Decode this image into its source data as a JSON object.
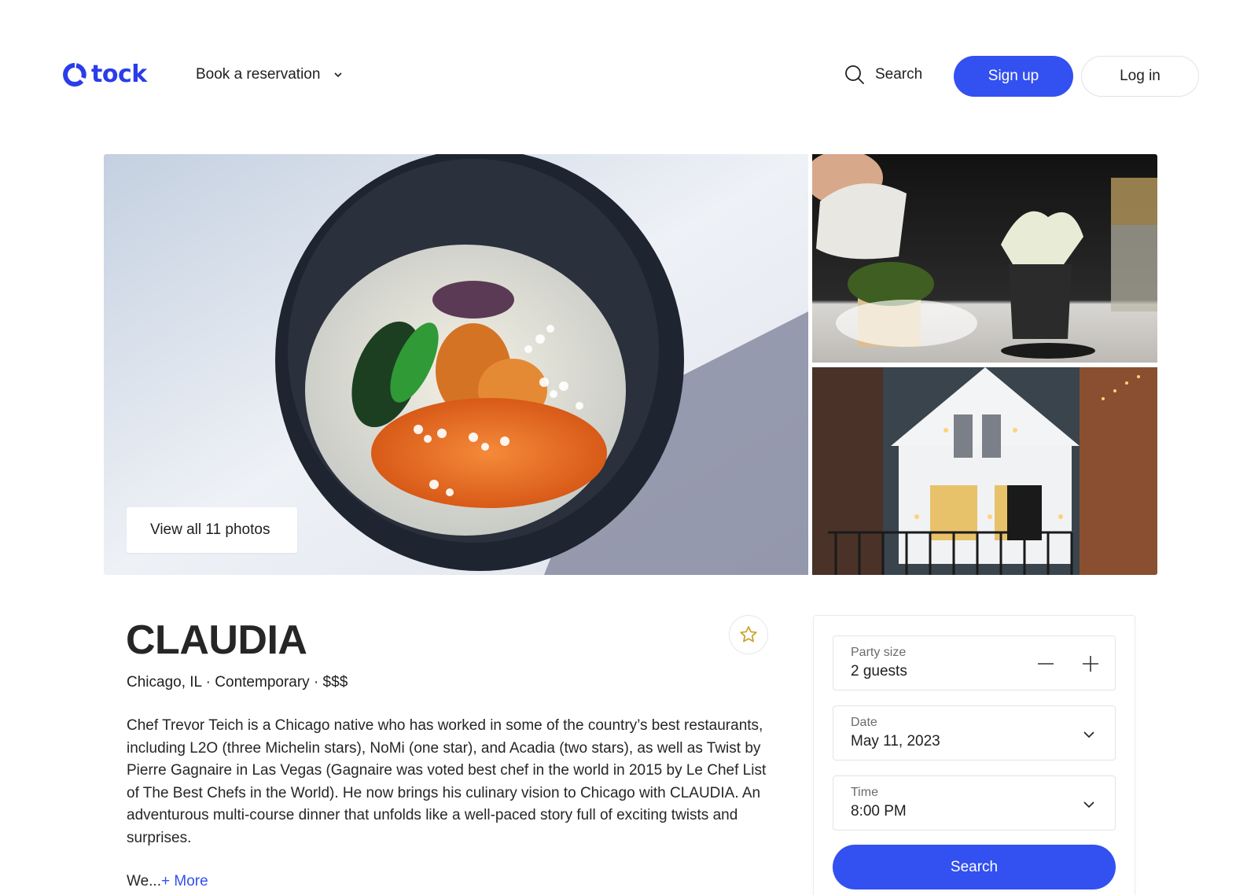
{
  "header": {
    "brand": "tock",
    "nav_book": "Book a reservation",
    "search_label": "Search",
    "signup_label": "Sign up",
    "login_label": "Log in"
  },
  "gallery": {
    "view_all_label": "View all 11 photos",
    "photos": [
      {
        "subject": "bowl with uni, trout roe and coriander flowers"
      },
      {
        "subject": "server pouring liquid over smoking moss dish"
      },
      {
        "subject": "white restaurant house exterior at dusk"
      }
    ]
  },
  "restaurant": {
    "name": "CLAUDIA",
    "subtitle": "Chicago, IL · Contemporary · $$$",
    "description": "Chef Trevor Teich is a Chicago native who has worked in some of the country’s best restaurants, including L2O (three Michelin stars), NoMi (one star), and Acadia (two stars), as well as Twist by Pierre Gagnaire in Las Vegas (Gagnaire was voted best chef in the world in 2015 by Le Chef List of The Best Chefs in the World). He now brings his culinary vision to Chicago with CLAUDIA. An adventurous multi-course dinner that unfolds like a well-paced story full of exciting twists and surprises.",
    "truncated_text": "We...",
    "more_label": "+ More"
  },
  "booking": {
    "party_label": "Party size",
    "party_value": "2 guests",
    "date_label": "Date",
    "date_value": "May 11, 2023",
    "time_label": "Time",
    "time_value": "8:00 PM",
    "search_label": "Search"
  },
  "colors": {
    "brand_blue": "#3350f0",
    "favorite_star": "#c9a227"
  },
  "icons": {
    "logo": "tock-logo-icon",
    "nav_chevron": "chevron-down-icon",
    "search": "search-icon",
    "favorite": "star-outline-icon",
    "decrement": "minus-icon",
    "increment": "plus-icon"
  }
}
